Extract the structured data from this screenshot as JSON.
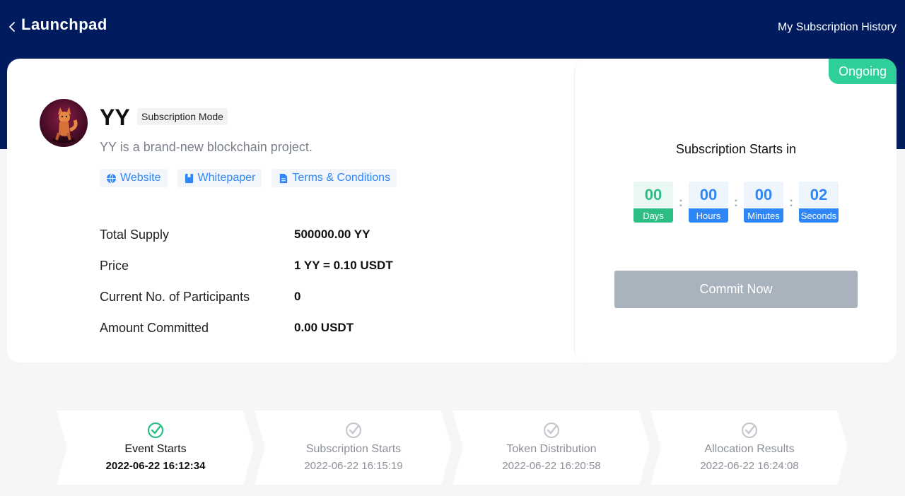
{
  "header": {
    "title": "Launchpad",
    "history_link": "My Subscription History"
  },
  "project": {
    "name": "YY",
    "mode": "Subscription Mode",
    "description": "YY is a brand-new blockchain project.",
    "links": [
      {
        "label": "Website",
        "icon": "globe-icon"
      },
      {
        "label": "Whitepaper",
        "icon": "book-icon"
      },
      {
        "label": "Terms & Conditions",
        "icon": "document-icon"
      }
    ],
    "info": [
      {
        "label": "Total Supply",
        "value": "500000.00 YY"
      },
      {
        "label": "Price",
        "value": "1 YY = 0.10 USDT"
      },
      {
        "label": "Current No. of Participants",
        "value": "0"
      },
      {
        "label": "Amount Committed",
        "value": "0.00 USDT"
      }
    ]
  },
  "subscription": {
    "status": "Ongoing",
    "countdown_title": "Subscription Starts in",
    "countdown": [
      {
        "value": "00",
        "label": "Days"
      },
      {
        "value": "00",
        "label": "Hours"
      },
      {
        "value": "00",
        "label": "Minutes"
      },
      {
        "value": "02",
        "label": "Seconds"
      }
    ],
    "commit_label": "Commit Now"
  },
  "timeline": [
    {
      "name": "Event Starts",
      "date": "2022-06-22 16:12:34",
      "active": true
    },
    {
      "name": "Subscription Starts",
      "date": "2022-06-22 16:15:19",
      "active": false
    },
    {
      "name": "Token Distribution",
      "date": "2022-06-22 16:20:58",
      "active": false
    },
    {
      "name": "Allocation Results",
      "date": "2022-06-22 16:24:08",
      "active": false
    }
  ],
  "colors": {
    "header_bg": "#001c5e",
    "accent_blue": "#2f86f6",
    "accent_green": "#2ebd85",
    "status_green": "#2ecf9a",
    "disabled_button": "#a8b3bd"
  }
}
